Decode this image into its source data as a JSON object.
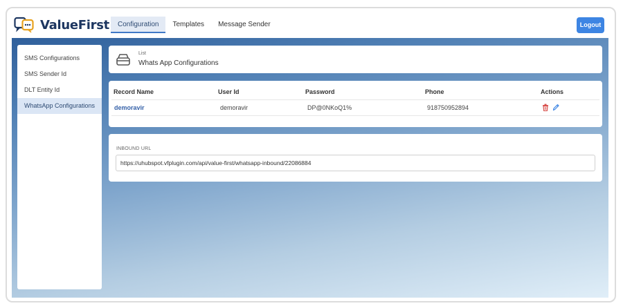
{
  "app": {
    "brand": "ValueFirst"
  },
  "nav": {
    "tabs": [
      {
        "label": "Configuration",
        "active": true
      },
      {
        "label": "Templates",
        "active": false
      },
      {
        "label": "Message Sender",
        "active": false
      }
    ],
    "logout_label": "Logout"
  },
  "sidebar": {
    "items": [
      {
        "label": "SMS Configurations"
      },
      {
        "label": "SMS Sender Id"
      },
      {
        "label": "DLT Entity Id"
      },
      {
        "label": "WhatsApp Configurations",
        "active": true
      }
    ]
  },
  "list_header": {
    "small": "List",
    "title": "Whats App Configurations",
    "icon": "inbox-tray-icon"
  },
  "table": {
    "columns": [
      "Record Name",
      "User Id",
      "Password",
      "Phone",
      "Actions"
    ],
    "rows": [
      {
        "record_name": "demoravir",
        "user_id": "demoravir",
        "password": "DP@0NKoQ1%",
        "phone": "918750952894"
      }
    ],
    "action_icons": [
      "trash-icon",
      "pencil-icon"
    ]
  },
  "inbound": {
    "label": "INBOUND URL",
    "value": "https://uhubspot.vfplugin.com/api/value-first/whatsapp-inbound/22086884"
  },
  "colors": {
    "brand_navy": "#1d3660",
    "accent_blue": "#3d85e3",
    "delete_red": "#d9534f",
    "link_blue": "#3561a8"
  }
}
